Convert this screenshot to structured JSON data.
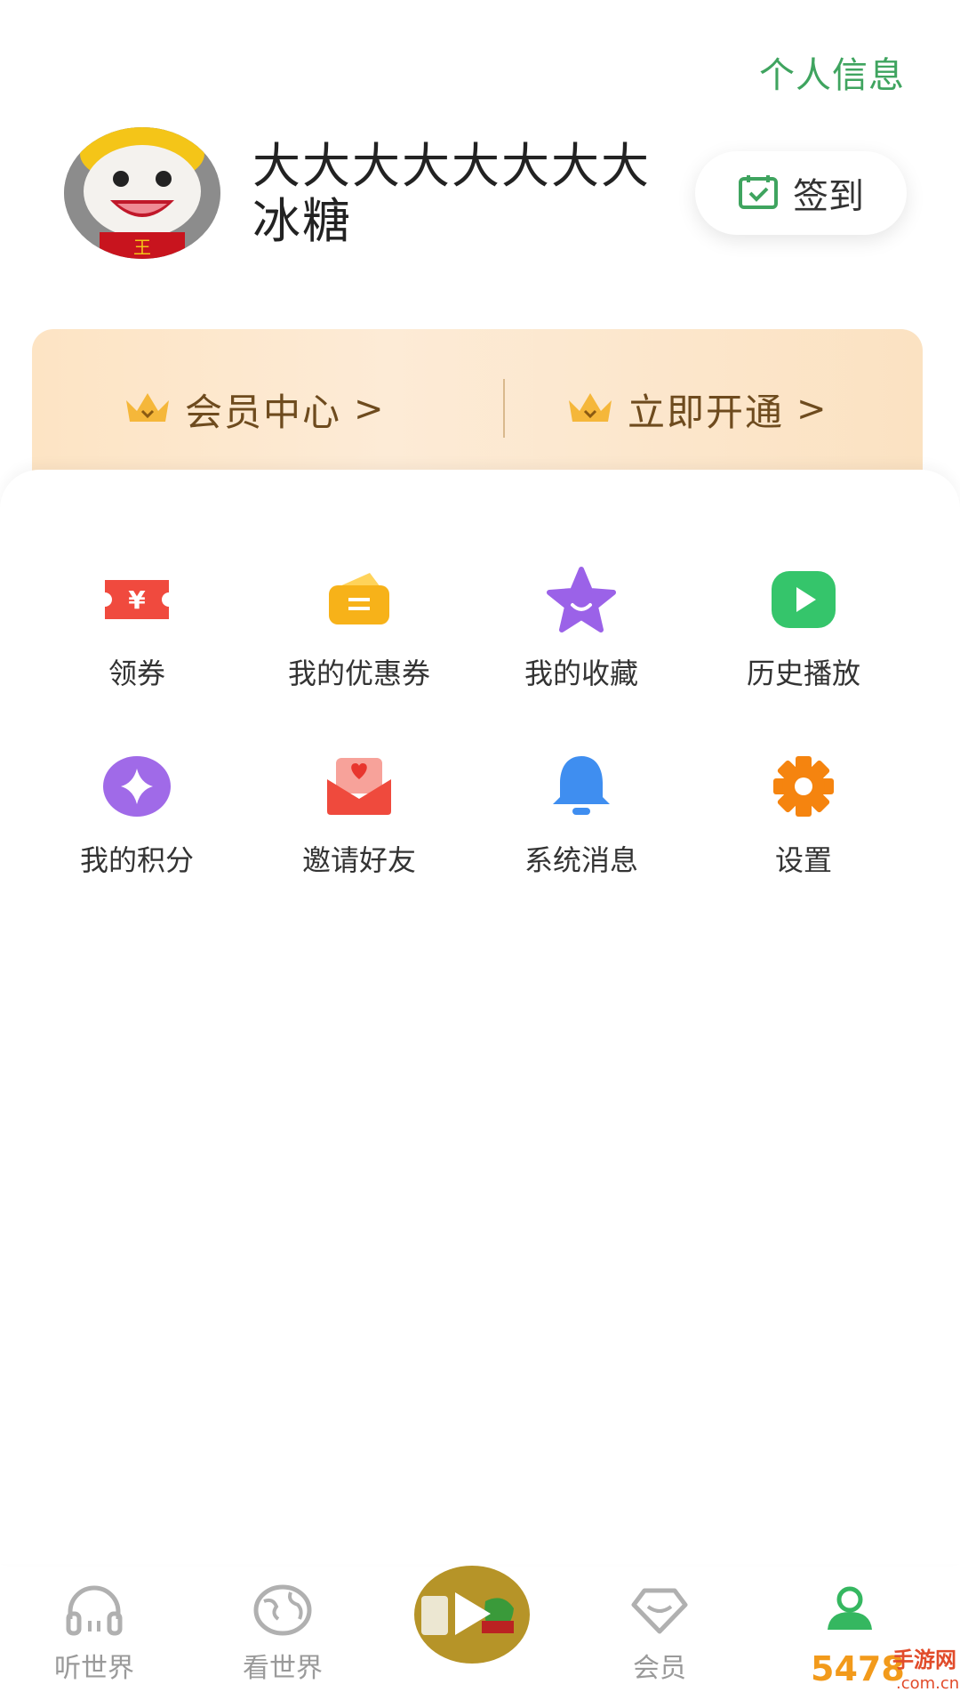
{
  "header": {
    "profile_link": "个人信息",
    "username": "大大大大大大大大冰糖",
    "checkin_label": "签到"
  },
  "vip": {
    "member_center": "会员中心",
    "activate_now": "立即开通",
    "chevron": ">"
  },
  "grid": [
    {
      "label": "领券",
      "icon": "coupon-ticket-icon"
    },
    {
      "label": "我的优惠券",
      "icon": "wallet-coupon-icon"
    },
    {
      "label": "我的收藏",
      "icon": "star-icon"
    },
    {
      "label": "历史播放",
      "icon": "play-history-icon"
    },
    {
      "label": "我的积分",
      "icon": "points-diamond-icon"
    },
    {
      "label": "邀请好友",
      "icon": "invite-envelope-icon"
    },
    {
      "label": "系统消息",
      "icon": "bell-icon"
    },
    {
      "label": "设置",
      "icon": "gear-icon"
    }
  ],
  "tabbar": {
    "listen": "听世界",
    "watch": "看世界",
    "member": "会员"
  },
  "watermark": {
    "num": "5478",
    "text": "手游网",
    "sub": ".com.cn"
  },
  "colors": {
    "accent_green": "#3fa45f",
    "vip_text": "#6e4b1e",
    "tab_inactive": "#9a9a9a"
  }
}
